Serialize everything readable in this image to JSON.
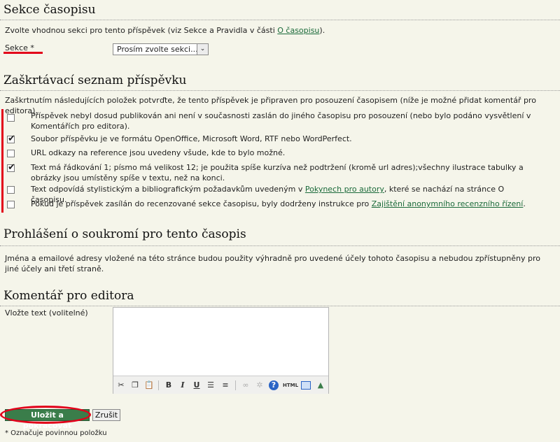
{
  "section": {
    "title": "Sekce časopisu",
    "intro_before": "Zvolte vhodnou sekci pro tento příspěvek (viz Sekce a Pravidla v části ",
    "intro_link": "O časopisu",
    "intro_after": ").",
    "label": "Sekce *",
    "select_value": "Prosím zvolte sekci..."
  },
  "checklist": {
    "title": "Zaškrtávací seznam příspěvku",
    "intro": "Zaškrtnutím následujících položek potvrďte, že tento příspěvek je připraven pro posouzení časopisem (níže je možné přidat komentář pro editora).",
    "items": [
      {
        "text": "Příspěvek nebyl dosud publikován ani není v současnosti zaslán do jiného časopisu pro posouzení (nebo bylo podáno vysvětlení v Komentářích pro editora).",
        "checked": false
      },
      {
        "text": "Soubor příspěvku je ve formátu OpenOffice, Microsoft Word, RTF nebo WordPerfect.",
        "checked": true
      },
      {
        "text": "URL odkazy na reference jsou uvedeny všude, kde to bylo možné.",
        "checked": false
      },
      {
        "text": "Text má řádkování 1; písmo má velikost 12; je použita spíše kurzíva než podtržení (kromě url adres);všechny ilustrace tabulky a obrázky jsou umístěny spíše v textu, než na konci.",
        "checked": true
      },
      {
        "text_before": "Text odpovídá stylistickým a bibliografickým požadavkům uvedeným v ",
        "link": "Pokynech pro autory",
        "text_after": ", které se nachází na stránce O časopisu.",
        "checked": false
      },
      {
        "text_before": "Pokud je příspěvek zasílán do recenzované sekce časopisu, byly dodrženy instrukce pro ",
        "link": "Zajištění anonymního recenzního řízení",
        "text_after": ".",
        "checked": false
      }
    ]
  },
  "privacy": {
    "title": "Prohlášení o soukromí pro tento časopis",
    "text": "Jména a emailové adresy vložené na této stránce budou použity výhradně pro uvedené účely tohoto časopisu a nebudou zpřístupněny pro jiné účely ani třetí straně."
  },
  "comment": {
    "title": "Komentář pro editora",
    "label": "Vložte text (volitelné)",
    "value": ""
  },
  "actions": {
    "save_label": "Uložit a pokračovat",
    "cancel_label": "Zrušit"
  },
  "footnote": "* Označuje povinnou položku",
  "colors": {
    "highlight": "#e2001a",
    "link": "#1b6a3a",
    "save_button": "#3a7d4a"
  }
}
